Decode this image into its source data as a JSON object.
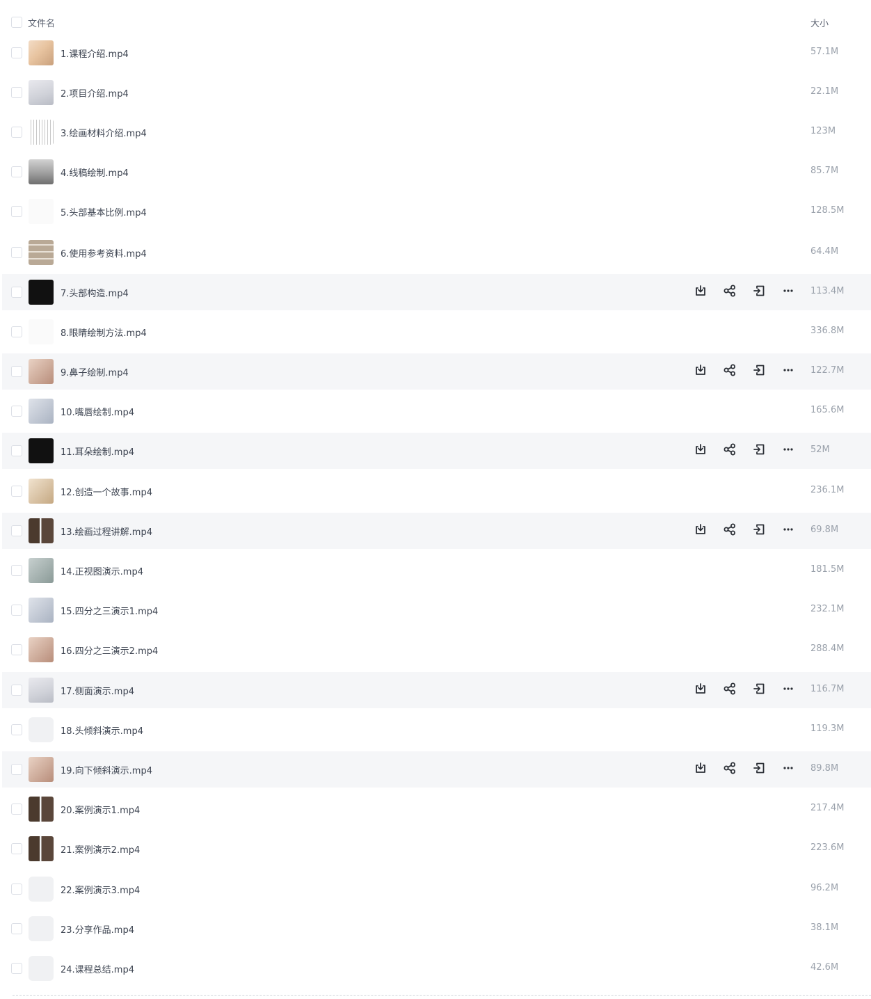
{
  "header": {
    "name_label": "文件名",
    "size_label": "大小"
  },
  "files": [
    {
      "name": "1.课程介绍.mp4",
      "size": "57.1M",
      "thumb": "t-skin",
      "highlight": false,
      "actions": false
    },
    {
      "name": "2.项目介绍.mp4",
      "size": "22.1M",
      "thumb": "t-sketch",
      "highlight": false,
      "actions": false
    },
    {
      "name": "3.绘画材料介绍.mp4",
      "size": "123M",
      "thumb": "t-grid",
      "highlight": false,
      "actions": false
    },
    {
      "name": "4.线稿绘制.mp4",
      "size": "85.7M",
      "thumb": "t-gray",
      "highlight": false,
      "actions": false
    },
    {
      "name": "5.头部基本比例.mp4",
      "size": "128.5M",
      "thumb": "t-white",
      "highlight": false,
      "actions": false
    },
    {
      "name": "6.使用参考资料.mp4",
      "size": "64.4M",
      "thumb": "t-tiles",
      "highlight": false,
      "actions": false
    },
    {
      "name": "7.头部构造.mp4",
      "size": "113.4M",
      "thumb": "t-dark",
      "highlight": true,
      "actions": true
    },
    {
      "name": "8.眼睛绘制方法.mp4",
      "size": "336.8M",
      "thumb": "t-white",
      "highlight": false,
      "actions": false
    },
    {
      "name": "9.鼻子绘制.mp4",
      "size": "122.7M",
      "thumb": "t-warm",
      "highlight": true,
      "actions": true
    },
    {
      "name": "10.嘴唇绘制.mp4",
      "size": "165.6M",
      "thumb": "t-face",
      "highlight": false,
      "actions": false
    },
    {
      "name": "11.耳朵绘制.mp4",
      "size": "52M",
      "thumb": "t-dark",
      "highlight": true,
      "actions": true
    },
    {
      "name": "12.创造一个故事.mp4",
      "size": "236.1M",
      "thumb": "t-hair",
      "highlight": false,
      "actions": false
    },
    {
      "name": "13.绘画过程讲解.mp4",
      "size": "69.8M",
      "thumb": "t-photo",
      "highlight": true,
      "actions": true
    },
    {
      "name": "14.正视图演示.mp4",
      "size": "181.5M",
      "thumb": "t-mix",
      "highlight": false,
      "actions": false
    },
    {
      "name": "15.四分之三演示1.mp4",
      "size": "232.1M",
      "thumb": "t-face",
      "highlight": false,
      "actions": false
    },
    {
      "name": "16.四分之三演示2.mp4",
      "size": "288.4M",
      "thumb": "t-warm",
      "highlight": false,
      "actions": false
    },
    {
      "name": "17.侧面演示.mp4",
      "size": "116.7M",
      "thumb": "t-sketch",
      "highlight": true,
      "actions": true
    },
    {
      "name": "18.头倾斜演示.mp4",
      "size": "119.3M",
      "thumb": "blank",
      "highlight": false,
      "actions": false
    },
    {
      "name": "19.向下倾斜演示.mp4",
      "size": "89.8M",
      "thumb": "t-warm",
      "highlight": true,
      "actions": true
    },
    {
      "name": "20.案例演示1.mp4",
      "size": "217.4M",
      "thumb": "t-photo",
      "highlight": false,
      "actions": false
    },
    {
      "name": "21.案例演示2.mp4",
      "size": "223.6M",
      "thumb": "t-photo",
      "highlight": false,
      "actions": false
    },
    {
      "name": "22.案例演示3.mp4",
      "size": "96.2M",
      "thumb": "blank",
      "highlight": false,
      "actions": false
    },
    {
      "name": "23.分享作品.mp4",
      "size": "38.1M",
      "thumb": "blank",
      "highlight": false,
      "actions": false
    },
    {
      "name": "24.课程总结.mp4",
      "size": "42.6M",
      "thumb": "blank",
      "highlight": false,
      "actions": false
    }
  ],
  "icons": {
    "download": "download-icon",
    "share": "share-icon",
    "move": "move-icon",
    "more": "more-icon"
  },
  "colors": {
    "row_highlight": "#f5f6f8",
    "icon": "#2b2f36",
    "size_text": "#9aa1ab"
  }
}
